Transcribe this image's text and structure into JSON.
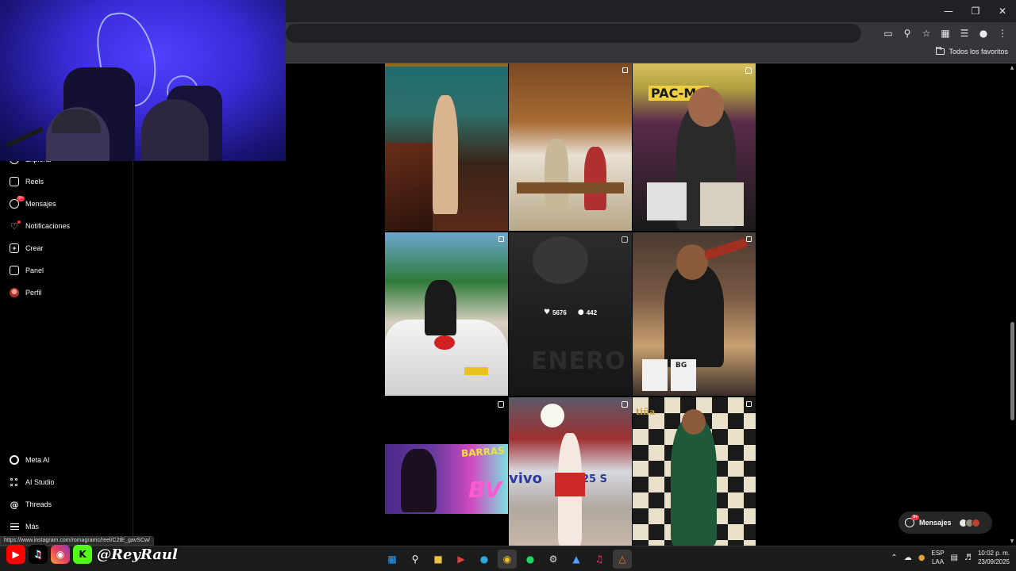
{
  "browser": {
    "bookmarks_folder_label": "Todos los favoritos"
  },
  "sidebar": {
    "items": [
      {
        "label": "Explorar",
        "icon": "compass-icon"
      },
      {
        "label": "Reels",
        "icon": "reels-icon"
      },
      {
        "label": "Mensajes",
        "icon": "messenger-icon",
        "badge": "9+"
      },
      {
        "label": "Notificaciones",
        "icon": "heart-icon"
      },
      {
        "label": "Crear",
        "icon": "plus-square-icon"
      },
      {
        "label": "Panel",
        "icon": "dashboard-icon"
      },
      {
        "label": "Perfil",
        "icon": "profile-avatar"
      }
    ],
    "bottom_items": [
      {
        "label": "Meta AI",
        "icon": "meta-ai-icon"
      },
      {
        "label": "AI Studio",
        "icon": "ai-studio-icon"
      },
      {
        "label": "Threads",
        "icon": "threads-icon"
      },
      {
        "label": "Más",
        "icon": "menu-icon"
      }
    ]
  },
  "grid": {
    "hovered_post": {
      "likes": "5676",
      "comments": "442"
    },
    "overlay_texts": {
      "pacman_sign": "PAC-MA",
      "enero_text": "ENERO",
      "barras_text": "BARRAS",
      "bva_text": "BV",
      "vivo_text": "vivo",
      "stadium_number": "25 S",
      "cup_text": "BG",
      "tina_logo": "tiña"
    }
  },
  "floating_messages": {
    "label": "Mensajes",
    "badge": "9+"
  },
  "status_bar": {
    "url": "https://www.instagram.com/romagramc/reel/C2tE_gavSCw/"
  },
  "overlay": {
    "handle": "@ReyRaul"
  },
  "taskbar": {
    "lang_top": "ESP",
    "lang_bottom": "LAA",
    "time": "10:02 p. m.",
    "date": "23/09/2025"
  }
}
